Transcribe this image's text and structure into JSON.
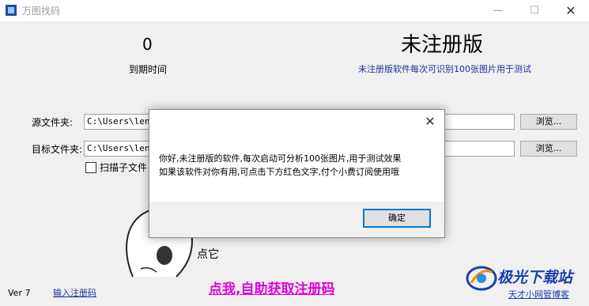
{
  "window": {
    "title": "万图找码",
    "min": "—",
    "max": "☐",
    "close": "✕"
  },
  "counter": "0",
  "expire_label": "到期时间",
  "version_title": "未注册版",
  "version_desc": "未注册版软件每次可识别100张图片用于测试",
  "source": {
    "label": "源文件夹:",
    "value": "C:\\Users\\leno",
    "browse": "浏览..."
  },
  "target": {
    "label": "目标文件夹:",
    "value": "C:\\Users\\leno",
    "browse": "浏览..."
  },
  "scan_sub": "扫描子文件",
  "point_it": "点它",
  "footer": {
    "version": "Ver  7",
    "enter_code": "输入注册码",
    "get_code": "点我,自助获取注册码"
  },
  "watermark": {
    "brand": "极光下载站",
    "sub": "天才小网管博客"
  },
  "dialog": {
    "close": "✕",
    "line1": "你好,未注册版的软件,每次启动可分析100张图片,用于测试效果",
    "line2": "如果该软件对你有用,可点击下方红色文字,付个小费订阅使用哦",
    "ok": "确定"
  }
}
